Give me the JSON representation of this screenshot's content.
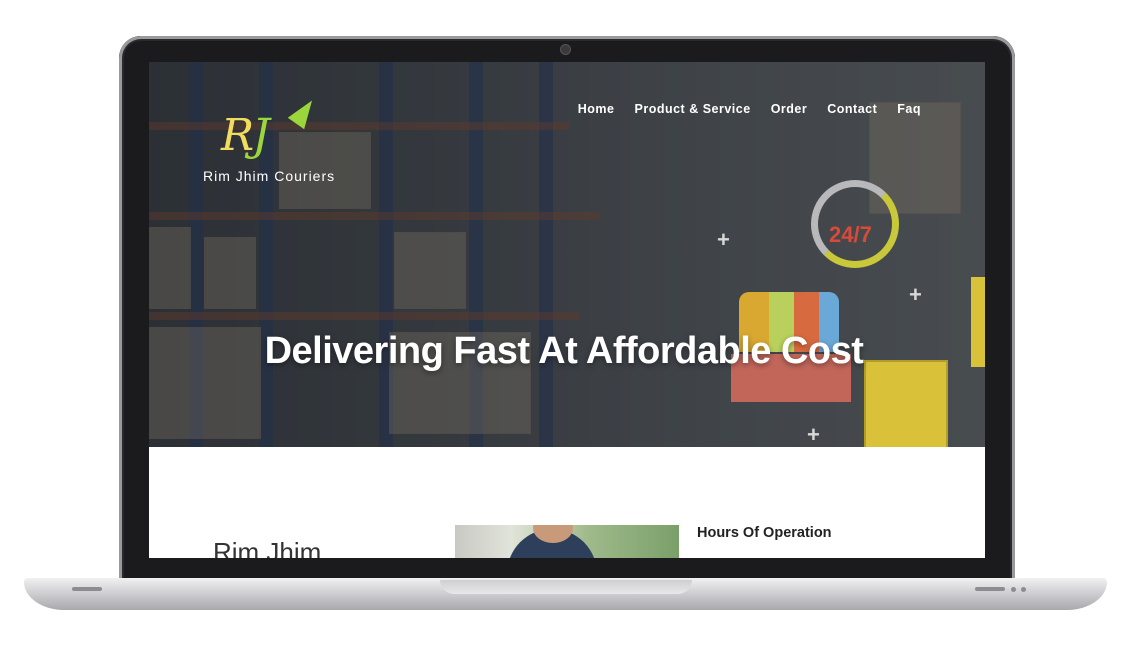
{
  "site": {
    "logo": {
      "mark_r": "R",
      "mark_j": "J",
      "tagline": "Rim Jhim Couriers"
    },
    "nav": [
      {
        "label": "Home"
      },
      {
        "label": "Product & Service"
      },
      {
        "label": "Order"
      },
      {
        "label": "Contact"
      },
      {
        "label": "Faq"
      }
    ],
    "hero": {
      "title": "Delivering Fast At Affordable Cost",
      "badge": "24/7"
    },
    "content": {
      "brand_heading": "Rim Jhim",
      "hours_heading": "Hours Of Operation"
    }
  },
  "colors": {
    "logo_yellow": "#f2dc5d",
    "logo_green": "#9bd63a",
    "badge_red": "#d94a3a"
  }
}
